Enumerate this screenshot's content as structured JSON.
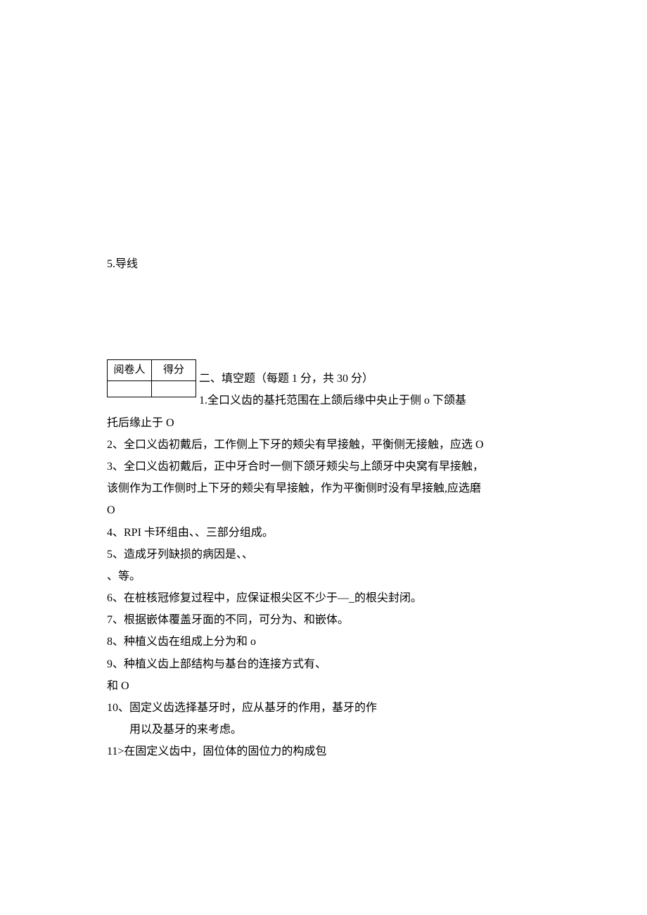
{
  "top": {
    "line": "5.导线"
  },
  "table": {
    "h1": "阅卷人",
    "h2": "得分"
  },
  "section2": {
    "header": "二、填空题（每题 1 分，共 30 分）",
    "q1a": "1.全口义齿的基托范围在上颌后缘中央止于侧 o 下颌基",
    "q1b": "托后缘止于 O",
    "q2": "2、全口义齿初戴后，工作侧上下牙的颊尖有早接触，平衡侧无接触，应选 O",
    "q3a": "3、全口义齿初戴后，正中牙合时一侧下颌牙颊尖与上颌牙中央窝有早接触，",
    "q3b": "该侧作为工作侧时上下牙的颊尖有早接触，作为平衡侧时没有早接触,应选磨",
    "q3c": "O",
    "q4": "4、RPI 卡环组由、、三部分组成。",
    "q5a": "5、造成牙列缺损的病因是、、",
    "q5b": "、等。",
    "q6": "6、在桩核冠修复过程中，应保证根尖区不少于—_的根尖封闭。",
    "q7": "7、根据嵌体覆盖牙面的不同，可分为、和嵌体。",
    "q8": "8、种植义齿在组成上分为和 o",
    "q9a": "9、种植义齿上部结构与基台的连接方式有、",
    "q9b": "和 O",
    "q10a": "10、固定义齿选择基牙时，应从基牙的作用，基牙的作",
    "q10b": "用以及基牙的来考虑。",
    "q11": "11>在固定义齿中，固位体的固位力的构成包"
  }
}
